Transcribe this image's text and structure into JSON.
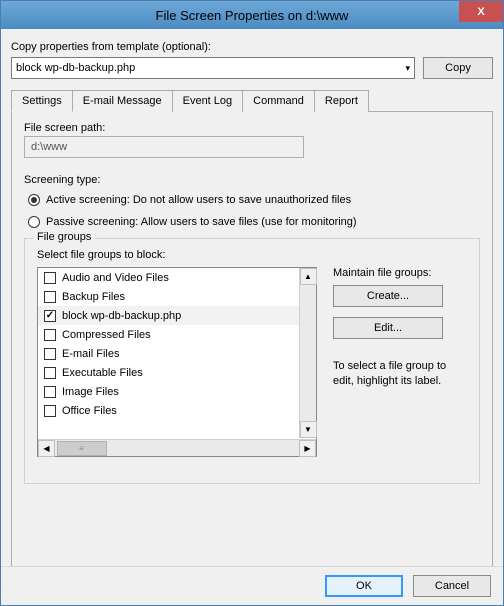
{
  "window": {
    "title": "File Screen Properties on d:\\www",
    "close_glyph": "X"
  },
  "template": {
    "label": "Copy properties from template (optional):",
    "selected": "block wp-db-backup.php",
    "copy_label": "Copy"
  },
  "tabs": {
    "settings": "Settings",
    "email": "E-mail Message",
    "eventlog": "Event Log",
    "command": "Command",
    "report": "Report"
  },
  "settings_panel": {
    "path_label": "File screen path:",
    "path_value": "d:\\www",
    "screening_type_label": "Screening type:",
    "active_label": "Active screening: Do not allow users to save unauthorized files",
    "passive_label": "Passive screening: Allow users to save files (use for monitoring)",
    "filegroups_box_title": "File groups",
    "select_label": "Select file groups to block:",
    "items": [
      {
        "label": "Audio and Video Files",
        "checked": false
      },
      {
        "label": "Backup Files",
        "checked": false
      },
      {
        "label": "block wp-db-backup.php",
        "checked": true
      },
      {
        "label": "Compressed Files",
        "checked": false
      },
      {
        "label": "E-mail Files",
        "checked": false
      },
      {
        "label": "Executable Files",
        "checked": false
      },
      {
        "label": "Image Files",
        "checked": false
      },
      {
        "label": "Office Files",
        "checked": false
      }
    ],
    "maintain_label": "Maintain file groups:",
    "create_label": "Create...",
    "edit_label": "Edit...",
    "hint": "To select a file group to edit, highlight its label."
  },
  "footer": {
    "ok": "OK",
    "cancel": "Cancel"
  }
}
